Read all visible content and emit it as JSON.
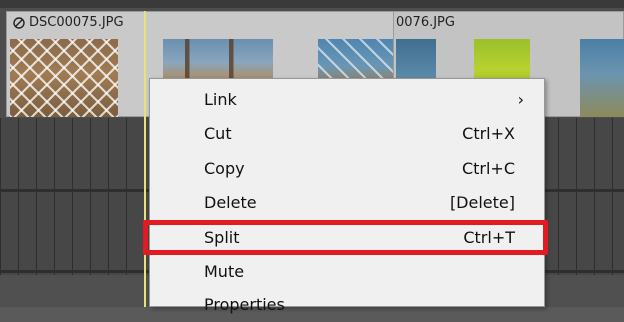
{
  "clips": [
    {
      "name": "DSC00075.JPG"
    },
    {
      "name": "0076.JPG"
    }
  ],
  "context_menu": {
    "items": [
      {
        "label": "Link",
        "shortcut": "",
        "submenu_arrow": "›"
      },
      {
        "label": "Cut",
        "shortcut": "Ctrl+X"
      },
      {
        "label": "Copy",
        "shortcut": "Ctrl+C"
      },
      {
        "label": "Delete",
        "shortcut": "[Delete]"
      },
      {
        "label": "Split",
        "shortcut": "Ctrl+T"
      },
      {
        "label": "Mute",
        "shortcut": ""
      },
      {
        "label": "Properties",
        "shortcut": ""
      }
    ],
    "highlighted_item": "Split",
    "highlight_color": "#e21b23"
  },
  "colors": {
    "playhead": "#e8e27a",
    "menu_background": "#f0f0f0"
  }
}
